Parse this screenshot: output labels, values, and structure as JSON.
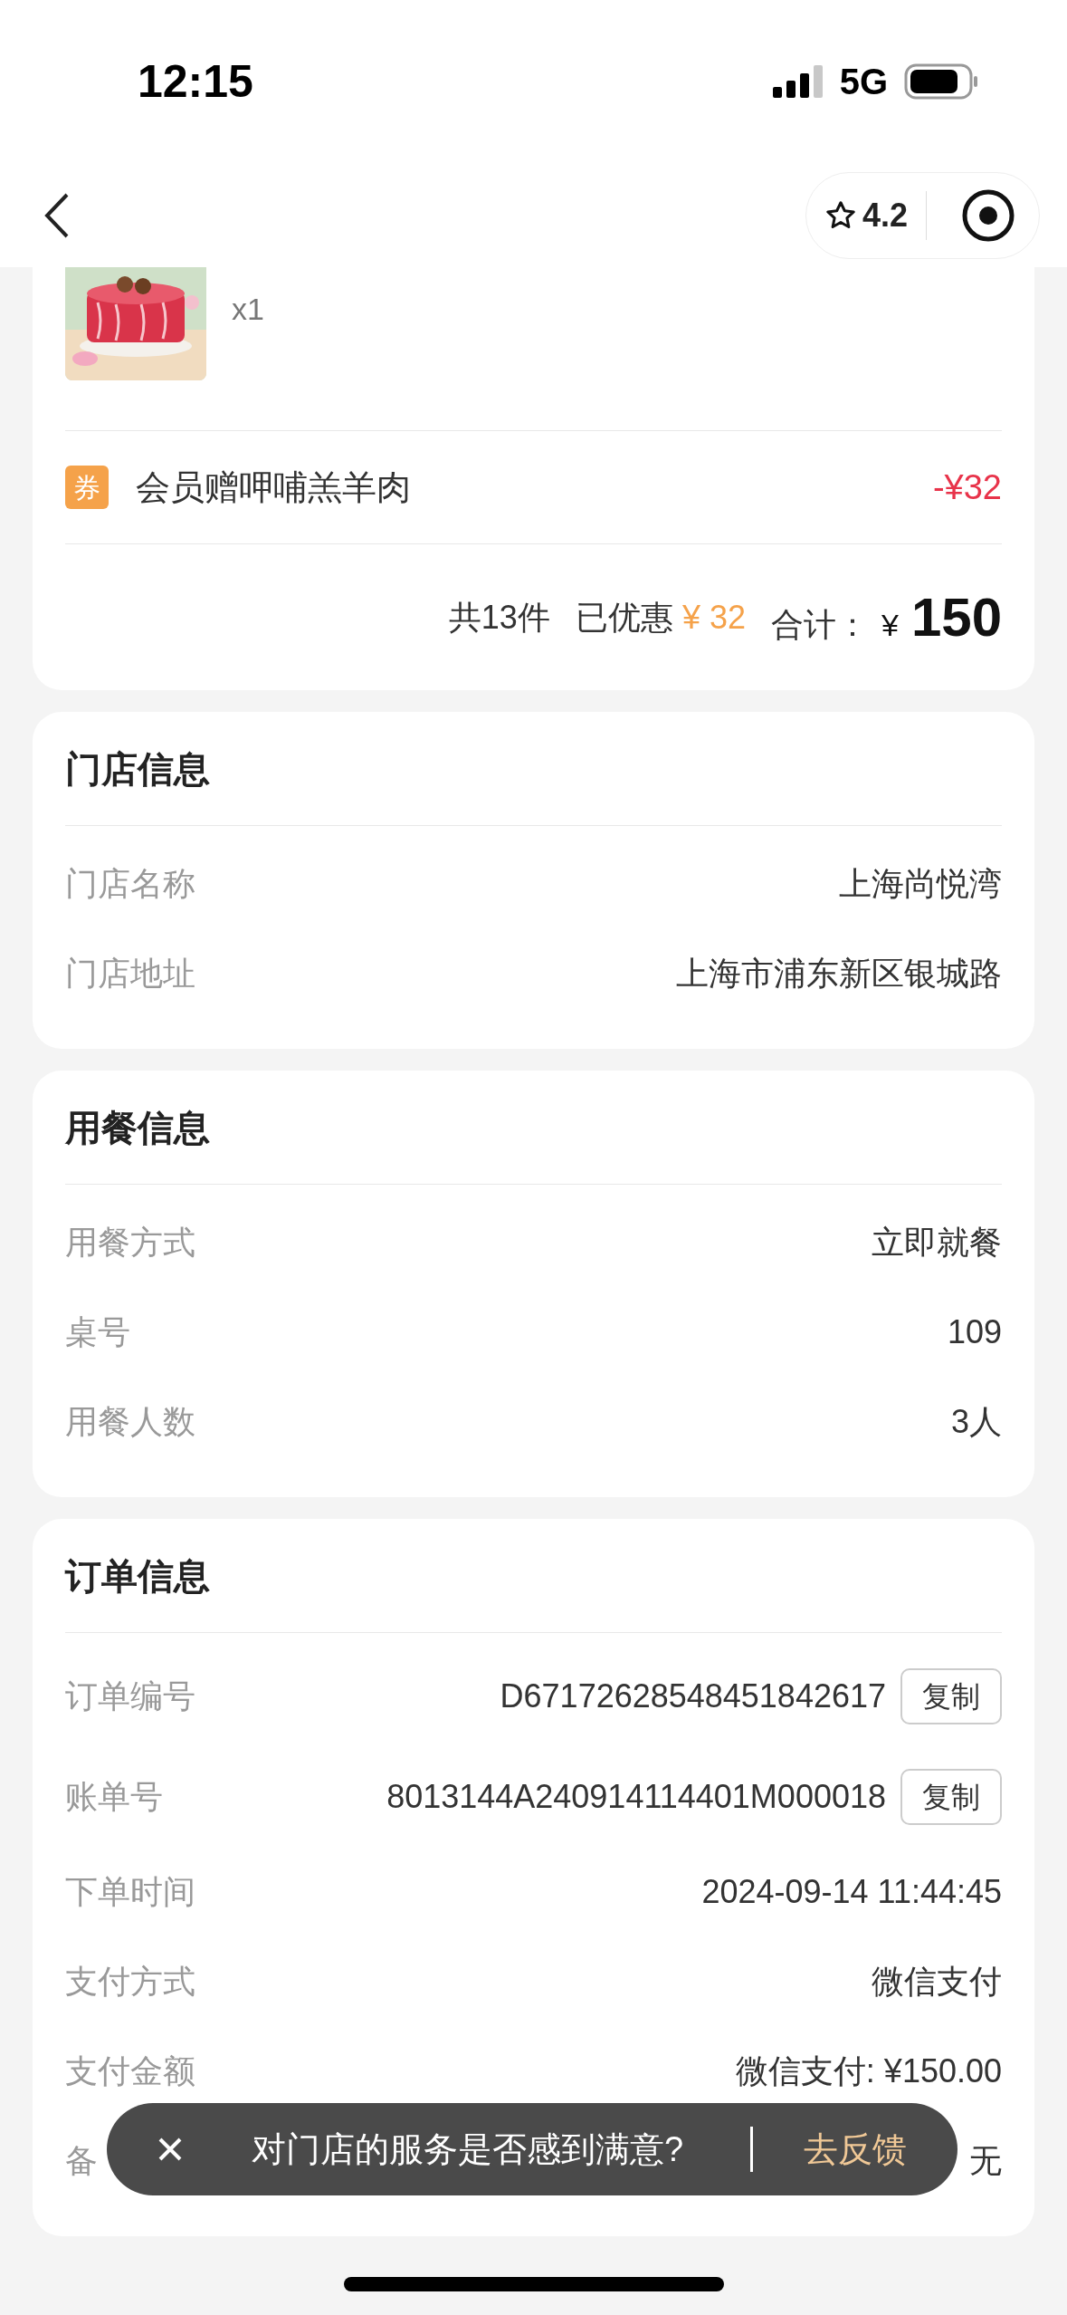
{
  "status_bar": {
    "time": "12:15",
    "network": "5G"
  },
  "nav": {
    "rating": "4.2"
  },
  "product": {
    "quantity": "x1"
  },
  "coupon": {
    "badge": "券",
    "name": "会员赠呷哺羔羊肉",
    "amount": "-¥32"
  },
  "summary": {
    "count": "共13件",
    "discount_label": "已优惠",
    "discount": "¥ 32",
    "total_label": "合计：",
    "currency": "¥",
    "total": "150"
  },
  "sections": [
    {
      "title": "门店信息",
      "rows": [
        {
          "label": "门店名称",
          "value": "上海尚悦湾"
        },
        {
          "label": "门店地址",
          "value": "上海市浦东新区银城路"
        }
      ]
    },
    {
      "title": "用餐信息",
      "rows": [
        {
          "label": "用餐方式",
          "value": "立即就餐"
        },
        {
          "label": "桌号",
          "value": "109"
        },
        {
          "label": "用餐人数",
          "value": "3人"
        }
      ]
    },
    {
      "title": "订单信息",
      "rows": [
        {
          "label": "订单编号",
          "value": "D67172628548451842617",
          "action": "复制"
        },
        {
          "label": "账单号",
          "value": "8013144A240914114401M000018",
          "action": "复制"
        },
        {
          "label": "下单时间",
          "value": "2024-09-14 11:44:45"
        },
        {
          "label": "支付方式",
          "value": "微信支付"
        },
        {
          "label": "支付金额",
          "value": "微信支付: ¥150.00"
        },
        {
          "label": "备",
          "value": "无"
        }
      ]
    }
  ],
  "toast": {
    "message": "对门店的服务是否感到满意?",
    "action": "去反馈"
  }
}
